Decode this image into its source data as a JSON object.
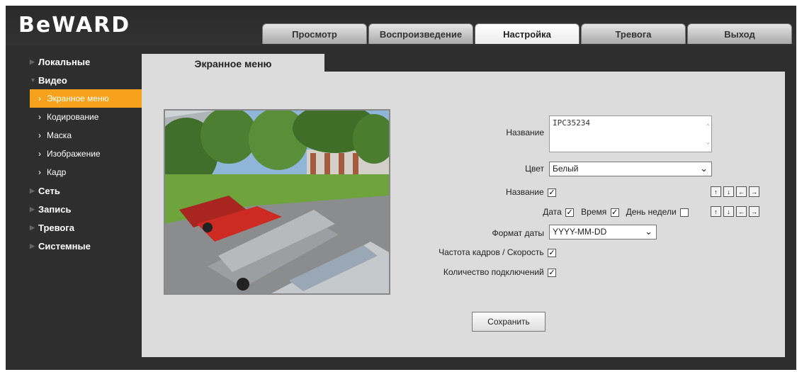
{
  "brand": {
    "logo_text": "BeWARD"
  },
  "nav": {
    "tabs": [
      {
        "label": "Просмотр"
      },
      {
        "label": "Воспроизведение"
      },
      {
        "label": "Настройка",
        "active": true
      },
      {
        "label": "Тревога"
      },
      {
        "label": "Выход"
      }
    ]
  },
  "sidebar": {
    "local": "Локальные",
    "video": "Видео",
    "video_items": [
      "Экранное меню",
      "Кодирование",
      "Маска",
      "Изображение",
      "Кадр"
    ],
    "network": "Сеть",
    "record": "Запись",
    "alarm": "Тревога",
    "system": "Системные"
  },
  "page": {
    "tab_title": "Экранное меню"
  },
  "form": {
    "name_label": "Название",
    "name_value": "IPC35234",
    "color_label": "Цвет",
    "color_value": "Белый",
    "show_name_label": "Название",
    "show_name_checked": true,
    "date_label": "Дата",
    "date_checked": true,
    "time_label": "Время",
    "time_checked": true,
    "weekday_label": "День недели",
    "weekday_checked": false,
    "date_format_label": "Формат даты",
    "date_format_value": "YYYY-MM-DD",
    "fps_label": "Частота кадров / Скорость",
    "fps_checked": true,
    "connections_label": "Количество подключений",
    "connections_checked": true,
    "save_label": "Сохранить"
  },
  "colors": {
    "accent": "#f7a21c",
    "panel": "#dcdcdc",
    "frame": "#2e2e2e"
  },
  "icons": [
    "arrow-up-icon",
    "arrow-down-icon",
    "arrow-left-icon",
    "arrow-right-icon",
    "chevron-right-icon",
    "triangle-right-icon",
    "triangle-down-icon"
  ]
}
